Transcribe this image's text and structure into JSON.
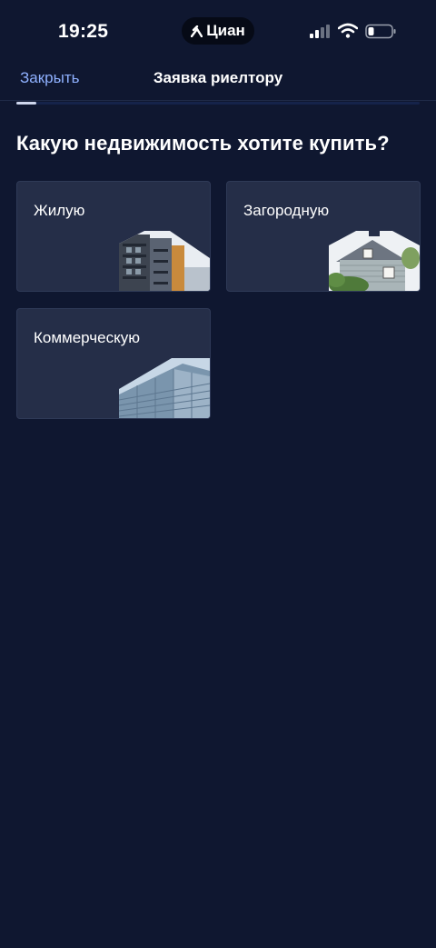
{
  "status_bar": {
    "time": "19:25",
    "brand": "Циан",
    "icons": [
      "signal-icon",
      "wifi-icon",
      "battery-icon"
    ]
  },
  "nav": {
    "close_label": "Закрыть",
    "title": "Заявка риелтору",
    "progress": 0.05
  },
  "main": {
    "question": "Какую недвижимость хотите купить?",
    "options": [
      {
        "label": "Жилую",
        "illustration": "apartment-building-photo"
      },
      {
        "label": "Загородную",
        "illustration": "country-house-photo"
      },
      {
        "label": "Коммерческую",
        "illustration": "office-building-photo"
      }
    ]
  },
  "colors": {
    "background": "#0f1730",
    "card": "#252e48",
    "accent": "#8fb1ff"
  }
}
